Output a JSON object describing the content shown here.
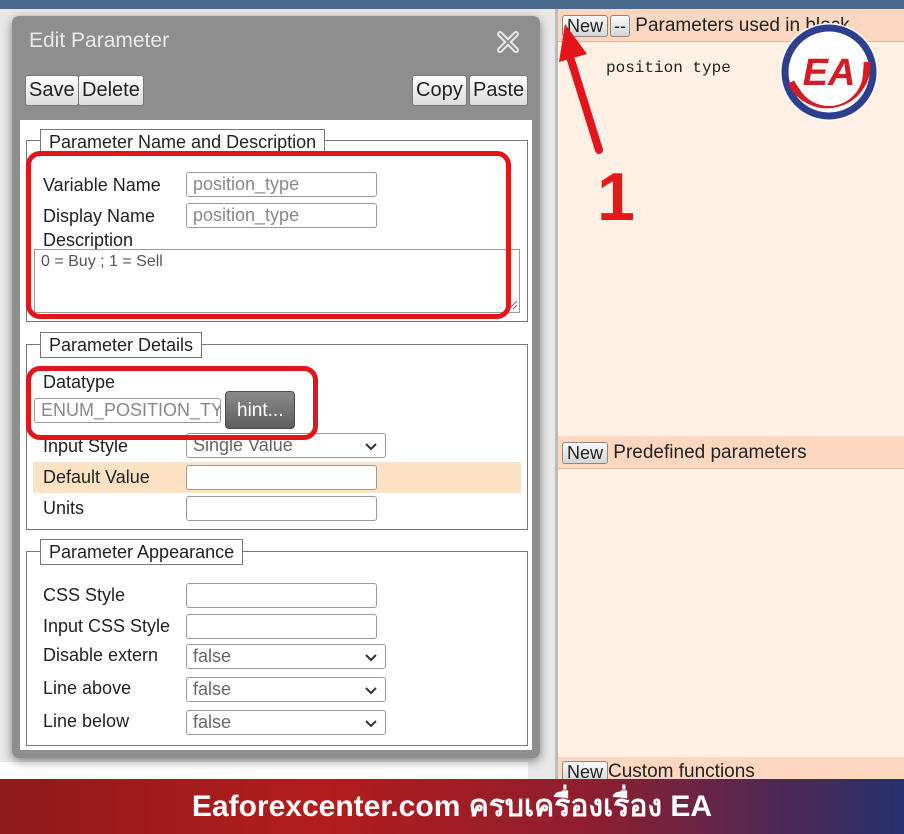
{
  "dialog": {
    "title": "Edit Parameter",
    "toolbar": {
      "save": "Save",
      "delete": "Delete",
      "copy": "Copy",
      "paste": "Paste"
    }
  },
  "name_section": {
    "legend": "Parameter Name and Description",
    "variable_name_label": "Variable Name",
    "variable_name_value": "position_type",
    "display_name_label": "Display Name",
    "display_name_value": "position_type",
    "description_label": "Description",
    "description_value": "0 = Buy ; 1 = Sell"
  },
  "details_section": {
    "legend": "Parameter Details",
    "datatype_label": "Datatype",
    "datatype_value": "ENUM_POSITION_TY",
    "hint_button": "hint...",
    "input_style_label": "Input Style",
    "input_style_value": "Single Value",
    "default_value_label": "Default Value",
    "default_value_value": "",
    "units_label": "Units",
    "units_value": ""
  },
  "appearance_section": {
    "legend": "Parameter Appearance",
    "css_style_label": "CSS Style",
    "css_style_value": "",
    "input_css_style_label": "Input CSS Style",
    "input_css_style_value": "",
    "disable_extern_label": "Disable extern",
    "disable_extern_value": "false",
    "line_above_label": "Line above",
    "line_above_value": "false",
    "line_below_label": "Line below",
    "line_below_value": "false"
  },
  "right_panels": {
    "params_in_block": {
      "new_button": "New",
      "dash_button": "--",
      "title": "Parameters used in block",
      "items": [
        "position type"
      ]
    },
    "predefined": {
      "new_button": "New",
      "title": "Predefined parameters"
    },
    "custom_functions": {
      "new_button": "New",
      "title": "Custom functions"
    }
  },
  "annotation": {
    "number": "1"
  },
  "logo": {
    "text": "EA"
  },
  "footer": {
    "text": "Eaforexcenter.com ครบเครื่องเรื่อง EA"
  },
  "colors": {
    "panel_header": "#fdd7bf",
    "panel_body": "#fff0e6",
    "dialog_frame": "#8e8e8e",
    "highlight_row": "#fde3c3",
    "annotation_red": "#e4141b",
    "top_bar": "#4a6a8e"
  }
}
